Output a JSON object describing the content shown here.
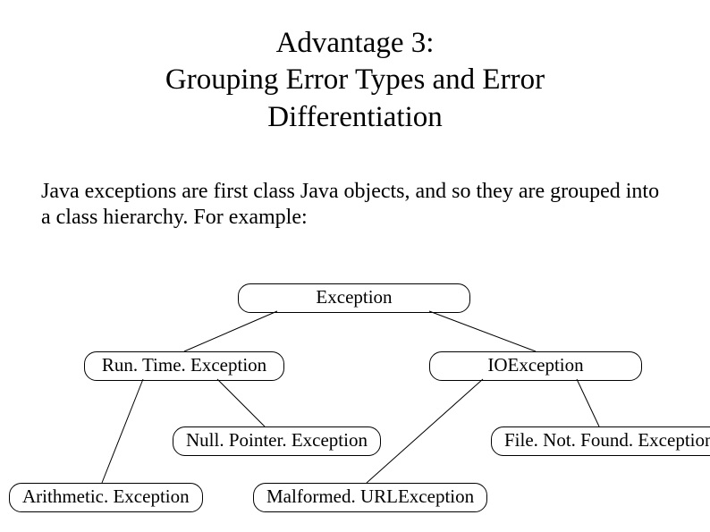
{
  "title": {
    "line1": "Advantage 3:",
    "line2": "Grouping Error Types and Error",
    "line3": "Differentiation"
  },
  "body": "Java exceptions are first class Java objects, and so they are grouped into a class hierarchy.  For example:",
  "nodes": {
    "exception": "Exception",
    "runtime": "Run. Time. Exception",
    "ioexception": "IOException",
    "nullpointer": "Null. Pointer. Exception",
    "filenotfound": "File. Not. Found. Exception",
    "arithmetic": "Arithmetic. Exception",
    "malformedurl": "Malformed. URLException"
  }
}
